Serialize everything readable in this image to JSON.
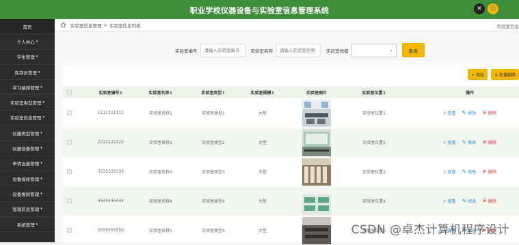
{
  "header": {
    "title": "职业学校仪器设备与实验室信息管理系统"
  },
  "sidebar": {
    "items": [
      {
        "label": "首页",
        "caret": ""
      },
      {
        "label": "个人中心",
        "caret": "▾"
      },
      {
        "label": "学生管理",
        "caret": "▾"
      },
      {
        "label": "库存员管理",
        "caret": "▾"
      },
      {
        "label": "学习编排管理",
        "caret": "▾"
      },
      {
        "label": "实验室类型管理",
        "caret": "▾"
      },
      {
        "label": "实验室信息管理",
        "caret": "▾"
      },
      {
        "label": "仪器类型管理",
        "caret": "▾"
      },
      {
        "label": "仪器设备管理",
        "caret": "▾"
      },
      {
        "label": "申请设备管理",
        "caret": "▾"
      },
      {
        "label": "设备报修管理",
        "caret": "▾"
      },
      {
        "label": "设备报损管理",
        "caret": "▾"
      },
      {
        "label": "管理信息管理",
        "caret": "▾"
      },
      {
        "label": "系统管理",
        "caret": "▾"
      }
    ]
  },
  "breadcrumb": {
    "level1": "实验室信息管理",
    "sep": ">",
    "level2": "实验室信息列表",
    "right": "实验室信息"
  },
  "search": {
    "no_label": "实验室编号",
    "no_placeholder": "请输入实验室编号",
    "name_label": "实验室名称",
    "name_placeholder": "请输入实验室名称",
    "size_label": "实验室规模",
    "size_value": "",
    "query_button": "查询"
  },
  "toolbar": {
    "add": "+ 添加",
    "batch_delete": "✕ 批量删除"
  },
  "table": {
    "headers": {
      "no": "实验室编号⇕",
      "name": "实验室名称⇕",
      "type": "实验室类型⇕",
      "size": "实验室规模⇕",
      "image": "实验室图片",
      "location": "实验室位置⇕",
      "ops": "操作"
    },
    "rows": [
      {
        "no": "1111111111",
        "name": "实验室名称1",
        "type": "实验室类型1",
        "size": "大型",
        "location": "实验室位置1"
      },
      {
        "no": "2222222222",
        "name": "实验室名称2",
        "type": "实验室类型2",
        "size": "大型",
        "location": "实验室位置2"
      },
      {
        "no": "3333333333",
        "name": "实验室名称3",
        "type": "实验室类型3",
        "size": "大型",
        "location": "实验室位置3"
      },
      {
        "no": "4444444444",
        "name": "实验室名称4",
        "type": "实验室类型4",
        "size": "大型",
        "location": "实验室位置4"
      },
      {
        "no": "5555555555",
        "name": "实验室名称5",
        "type": "实验室类型5",
        "size": "大型",
        "location": "实验室位置5"
      }
    ],
    "op_view": "查看",
    "op_edit": "修改",
    "op_delete": "删除"
  },
  "watermark": "CSDN @卓杰计算机程序设计",
  "colors": {
    "header_green": "#3f8f3a",
    "sidebar_dark": "#2d2d2d",
    "accent_yellow": "#f2b705",
    "row_alt": "#f1f7ef"
  },
  "icons": {
    "close": "close-icon",
    "user": "user-icon",
    "home": "home-icon",
    "view": "search-icon",
    "edit": "pencil-icon",
    "delete": "x-icon"
  }
}
